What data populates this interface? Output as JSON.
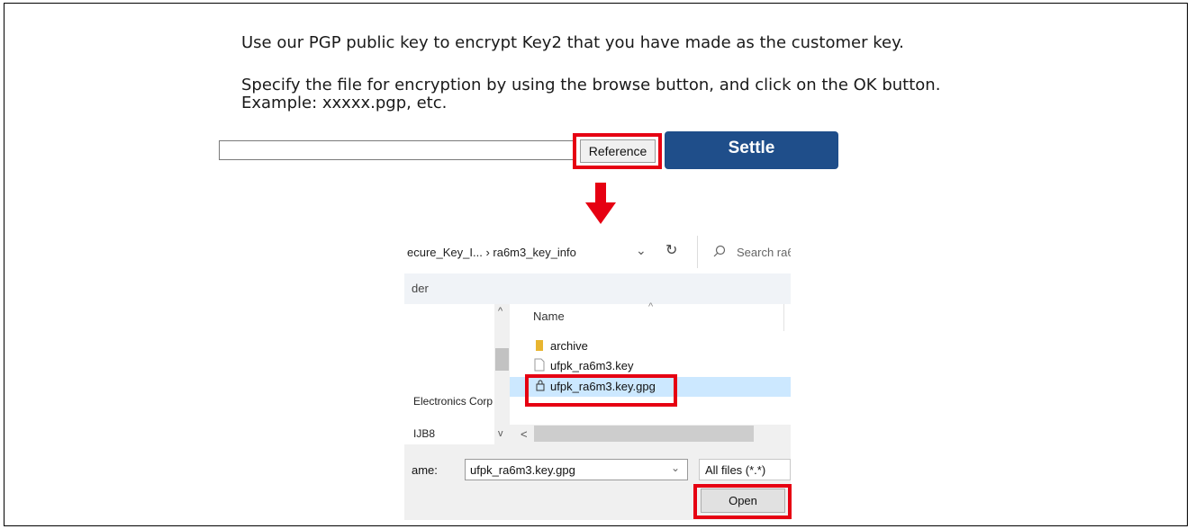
{
  "instructions": {
    "line1": "Use our PGP public key to encrypt Key2 that you have made as the customer key.",
    "line2": "Specify the file for encryption by using the browse button, and click on the OK button.",
    "line3": "Example: xxxxx.pgp, etc."
  },
  "form": {
    "file_value": "",
    "reference_label": "Reference",
    "settle_label": "Settle"
  },
  "dialog": {
    "breadcrumb": "ecure_Key_I...  ›  ra6m3_key_info",
    "search_placeholder": "Search ra6",
    "toolbar_fragment": "der",
    "nav_items": [
      "Electronics Corp",
      "IJB8"
    ],
    "column_name": "Name",
    "files": [
      {
        "label": "archive",
        "icon": "folder-icon"
      },
      {
        "label": "ufpk_ra6m3.key",
        "icon": "file-icon"
      },
      {
        "label": "ufpk_ra6m3.key.gpg",
        "icon": "encrypted-file-icon",
        "selected": true
      }
    ],
    "filename_label": "ame:",
    "filename_value": "ufpk_ra6m3.key.gpg",
    "filetype_value": "All files (*.*)",
    "open_label": "Open"
  },
  "colors": {
    "highlight": "#e60012",
    "settle": "#1f4e8a",
    "selection": "#cce8ff"
  }
}
